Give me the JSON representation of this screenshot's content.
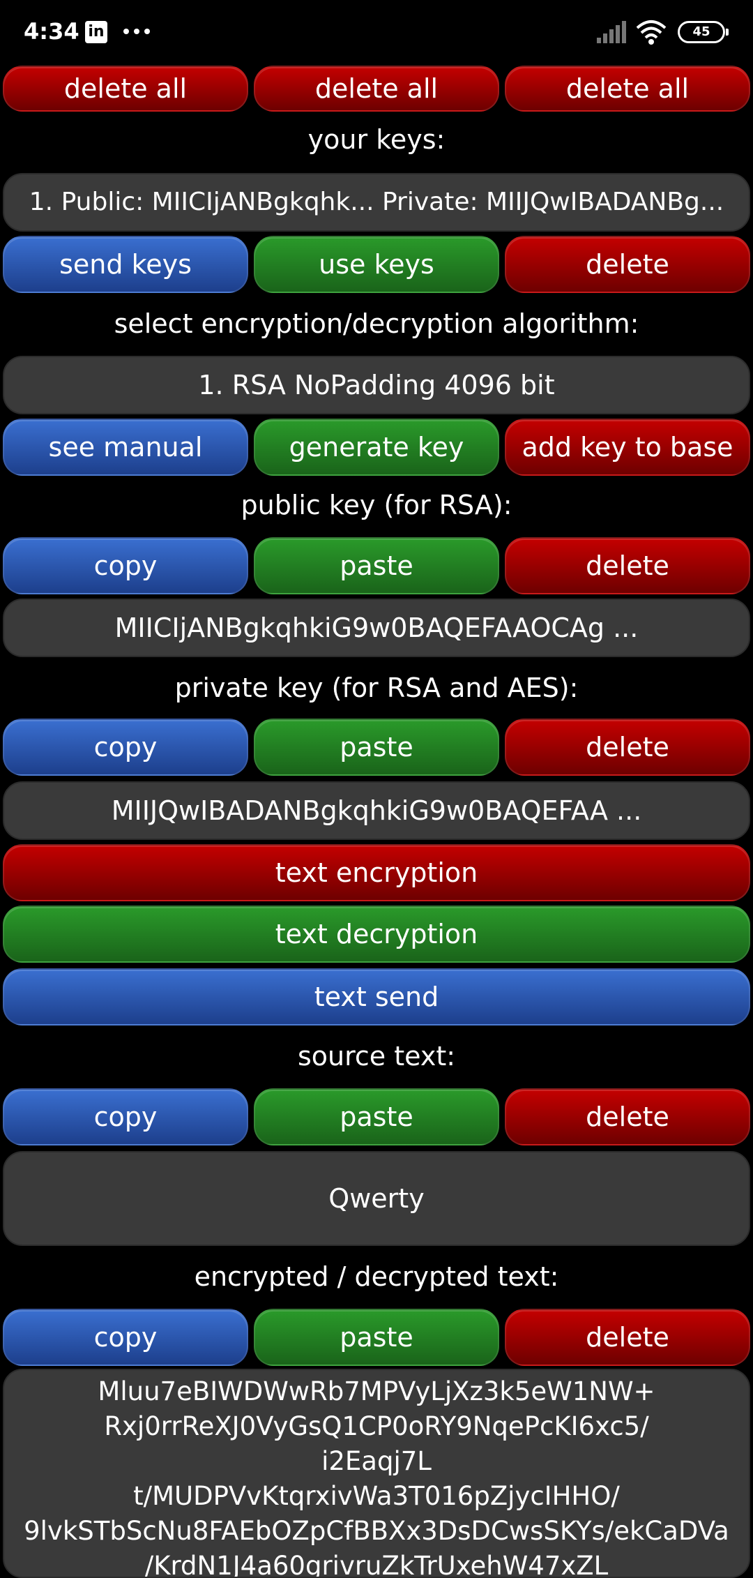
{
  "status_bar": {
    "time": "4:34",
    "linkedin_glyph": "in",
    "battery": "45"
  },
  "top_actions": [
    "delete all",
    "delete all",
    "delete all"
  ],
  "keys_section": {
    "label": "your keys:",
    "selected_key": "1. Public: MIICIjANBgkqhk... Private: MIIJQwIBADANBg...",
    "buttons": [
      "send keys",
      "use keys",
      "delete"
    ]
  },
  "algorithm_section": {
    "label": "select encryption/decryption algorithm:",
    "selected": "1. RSA NoPadding 4096 bit",
    "buttons": [
      "see manual",
      "generate key",
      "add key to base"
    ]
  },
  "public_key_section": {
    "label": "public key (for RSA):",
    "buttons": [
      "copy",
      "paste",
      "delete"
    ],
    "value": "MIICIjANBgkqhkiG9w0BAQEFAAOCAg ..."
  },
  "private_key_section": {
    "label": "private key (for RSA and AES):",
    "buttons": [
      "copy",
      "paste",
      "delete"
    ],
    "value": "MIIJQwIBADANBgkqhkiG9w0BAQEFAA ..."
  },
  "actions": {
    "encrypt": "text encryption",
    "decrypt": "text decryption",
    "send": "text send"
  },
  "source_section": {
    "label": "source text:",
    "buttons": [
      "copy",
      "paste",
      "delete"
    ],
    "value": "Qwerty"
  },
  "result_section": {
    "label": "encrypted / decrypted text:",
    "buttons": [
      "copy",
      "paste",
      "delete"
    ],
    "lines": [
      "Mluu7eBIWDWwRb7MPVyLjXz3k5eW1NW+",
      "Rxj0rrReXJ0VyGsQ1CP0oRY9NqePcKI6xc5/",
      "i2Eaqj7L",
      "t/MUDPVvKtqrxivWa3T016pZjycIHHO/",
      "9lvkSTbScNu8FAEbOZpCfBBXx3DsDCwsSKYs/ekCaDVa",
      "/KrdN1J4a60grivruZkTrUxehW47xZL"
    ]
  },
  "colors": {
    "red": "#c40000",
    "green": "#2a9a2a",
    "blue": "#3a6fd0",
    "field": "#3a3a3a",
    "background": "#000000"
  },
  "icons": [
    "linkedin-icon",
    "more-dots-icon",
    "signal-icon",
    "wifi-icon",
    "battery-icon"
  ]
}
